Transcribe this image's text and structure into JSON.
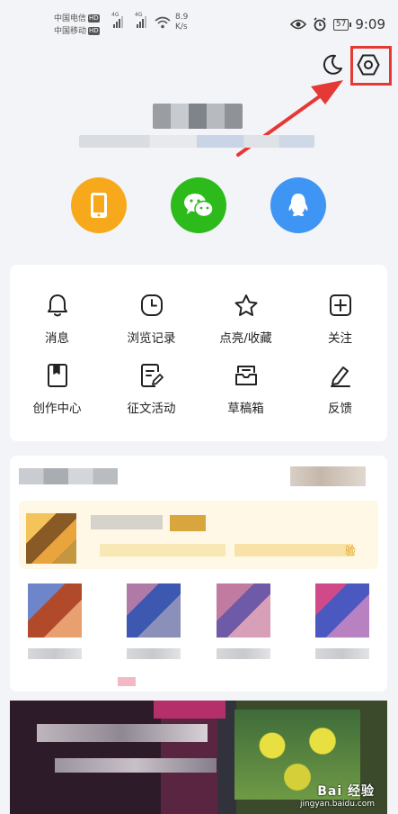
{
  "status_bar": {
    "carrier1": "中国电信",
    "carrier2": "中国移动",
    "hd": "HD",
    "net1": "4G",
    "net2": "4G",
    "speed_value": "8.9",
    "speed_unit": "K/s",
    "battery": "57",
    "time": "9:09"
  },
  "menu": {
    "items": [
      {
        "label": "消息",
        "icon": "bell-icon"
      },
      {
        "label": "浏览记录",
        "icon": "clock-icon"
      },
      {
        "label": "点亮/收藏",
        "icon": "star-icon"
      },
      {
        "label": "关注",
        "icon": "plus-square-icon"
      },
      {
        "label": "创作中心",
        "icon": "bookmark-doc-icon"
      },
      {
        "label": "征文活动",
        "icon": "edit-doc-icon"
      },
      {
        "label": "草稿箱",
        "icon": "inbox-icon"
      },
      {
        "label": "反馈",
        "icon": "pencil-icon"
      }
    ]
  },
  "login_options": [
    {
      "name": "phone",
      "color": "#f7a81b"
    },
    {
      "name": "wechat",
      "color": "#2dbb1c"
    },
    {
      "name": "qq",
      "color": "#3f95f4"
    }
  ],
  "content": {
    "vip_tag": "验"
  },
  "watermark": {
    "main": "Bai 经验",
    "sub": "jingyan.baidu.com"
  },
  "colors": {
    "highlight": "#e53935",
    "background": "#f3f4f7"
  }
}
